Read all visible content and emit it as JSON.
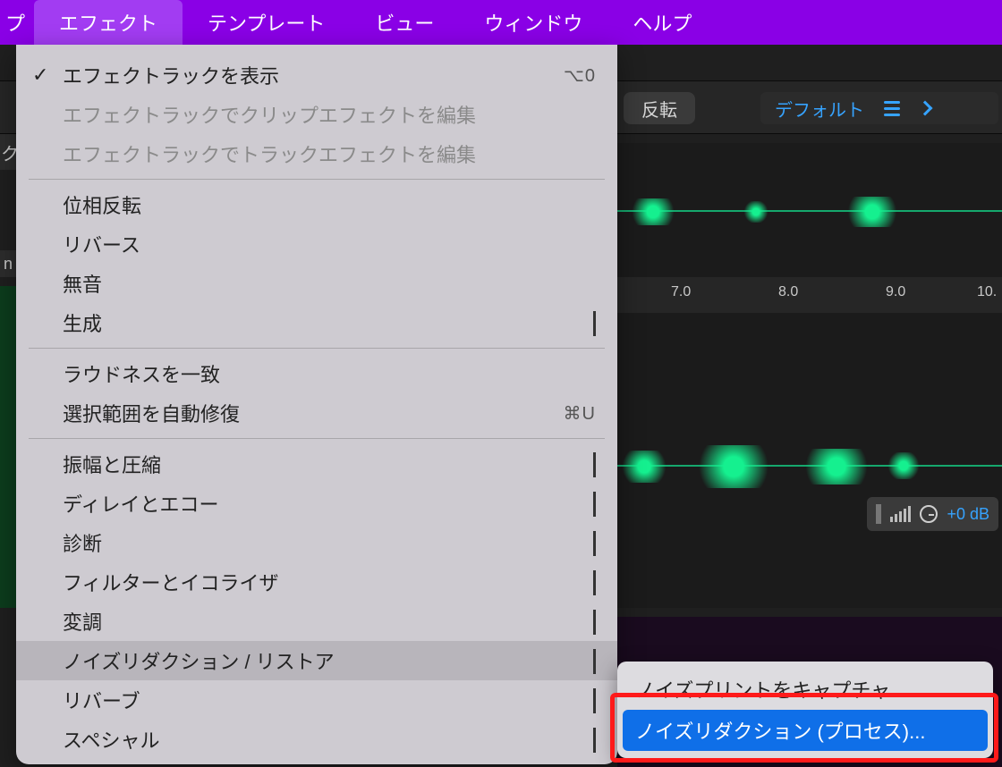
{
  "menubar": {
    "items": [
      {
        "label": "プ"
      },
      {
        "label": "エフェクト",
        "active": true
      },
      {
        "label": "テンプレート"
      },
      {
        "label": "ビュー"
      },
      {
        "label": "ウィンドウ"
      },
      {
        "label": "ヘルプ"
      }
    ]
  },
  "toolbar": {
    "invert_label": "反転",
    "preset_label": "デフォルト"
  },
  "ruler": {
    "t70": "7.0",
    "t80": "8.0",
    "t90": "9.0",
    "t10": "10."
  },
  "volume": {
    "value_label": "+0 dB"
  },
  "sidebar": {
    "frag1": "ク",
    "frag2": "n"
  },
  "dropdown": {
    "items": [
      {
        "label": "エフェクトラックを表示",
        "checked": true,
        "shortcut": "⌥0"
      },
      {
        "label": "エフェクトラックでクリップエフェクトを編集",
        "disabled": true
      },
      {
        "label": "エフェクトラックでトラックエフェクトを編集",
        "disabled": true
      },
      {
        "sep": true
      },
      {
        "label": "位相反転"
      },
      {
        "label": "リバース"
      },
      {
        "label": "無音"
      },
      {
        "label": "生成",
        "submenu": true
      },
      {
        "sep": true
      },
      {
        "label": "ラウドネスを一致"
      },
      {
        "label": "選択範囲を自動修復",
        "shortcut": "⌘U"
      },
      {
        "sep": true
      },
      {
        "label": "振幅と圧縮",
        "submenu": true
      },
      {
        "label": "ディレイとエコー",
        "submenu": true
      },
      {
        "label": "診断",
        "submenu": true
      },
      {
        "label": "フィルターとイコライザ",
        "submenu": true
      },
      {
        "label": "変調",
        "submenu": true
      },
      {
        "label": "ノイズリダクション / リストア",
        "submenu": true,
        "hover": true
      },
      {
        "label": "リバーブ",
        "submenu": true
      },
      {
        "label": "スペシャル",
        "submenu": true
      }
    ]
  },
  "submenu": {
    "items": [
      {
        "label": "ノイズプリントをキャプチャ"
      },
      {
        "label": "ノイズリダクション (プロセス)...",
        "highlighted": true
      }
    ]
  }
}
